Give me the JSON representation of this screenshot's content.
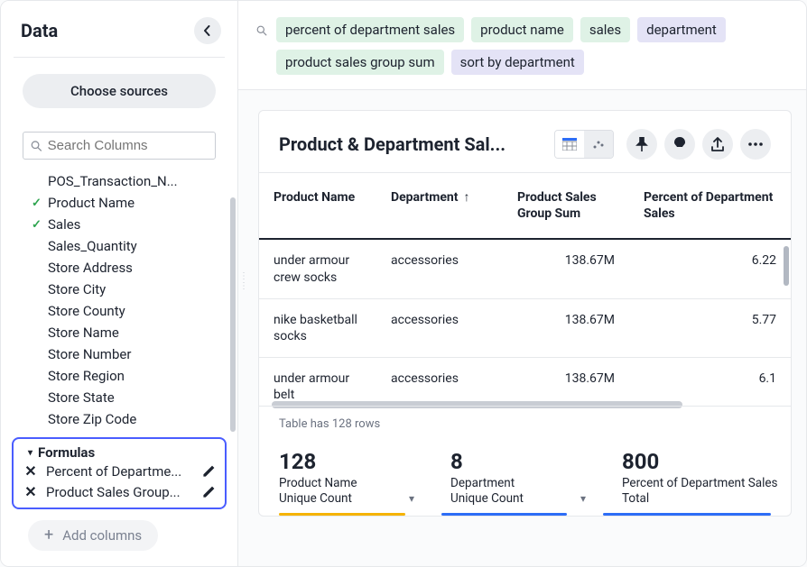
{
  "sidebar": {
    "title": "Data",
    "choose_sources_label": "Choose sources",
    "search_placeholder": "Search Columns",
    "columns": [
      {
        "label": "POS_Transaction_N...",
        "checked": false
      },
      {
        "label": "Product Name",
        "checked": true
      },
      {
        "label": "Sales",
        "checked": true
      },
      {
        "label": "Sales_Quantity",
        "checked": false
      },
      {
        "label": "Store Address",
        "checked": false
      },
      {
        "label": "Store City",
        "checked": false
      },
      {
        "label": "Store County",
        "checked": false
      },
      {
        "label": "Store Name",
        "checked": false
      },
      {
        "label": "Store Number",
        "checked": false
      },
      {
        "label": "Store Region",
        "checked": false
      },
      {
        "label": "Store State",
        "checked": false
      },
      {
        "label": "Store Zip Code",
        "checked": false
      }
    ],
    "formulas_label": "Formulas",
    "formulas": [
      {
        "label": "Percent of Departme..."
      },
      {
        "label": "Product Sales Group..."
      }
    ],
    "add_columns_label": "Add columns"
  },
  "search": {
    "chips": [
      {
        "label": "percent of department sales",
        "variant": "green"
      },
      {
        "label": "product name",
        "variant": "green"
      },
      {
        "label": "sales",
        "variant": "green"
      },
      {
        "label": "department",
        "variant": "purple"
      },
      {
        "label": "product sales group sum",
        "variant": "green"
      },
      {
        "label": "sort by department",
        "variant": "purple"
      }
    ]
  },
  "panel": {
    "title": "Product & Department Sal...",
    "columns": [
      "Product Name",
      "Department",
      "Product Sales Group Sum",
      "Percent of Department Sales"
    ],
    "rows": [
      {
        "name": "under armour crew socks",
        "dept": "accessories",
        "sum": "138.67M",
        "pct": "6.22"
      },
      {
        "name": "nike basketball socks",
        "dept": "accessories",
        "sum": "138.67M",
        "pct": "5.77"
      },
      {
        "name": "under armour belt",
        "dept": "accessories",
        "sum": "138.67M",
        "pct": "6.1"
      }
    ],
    "footer": "Table has 128 rows"
  },
  "summary": [
    {
      "value": "128",
      "label1": "Product Name",
      "label2": "Unique Count",
      "bar": "yellow"
    },
    {
      "value": "8",
      "label1": "Department",
      "label2": "Unique Count",
      "bar": "blue"
    },
    {
      "value": "800",
      "label1": "Percent of Department Sales",
      "label2": "Total",
      "bar": "blue"
    }
  ]
}
